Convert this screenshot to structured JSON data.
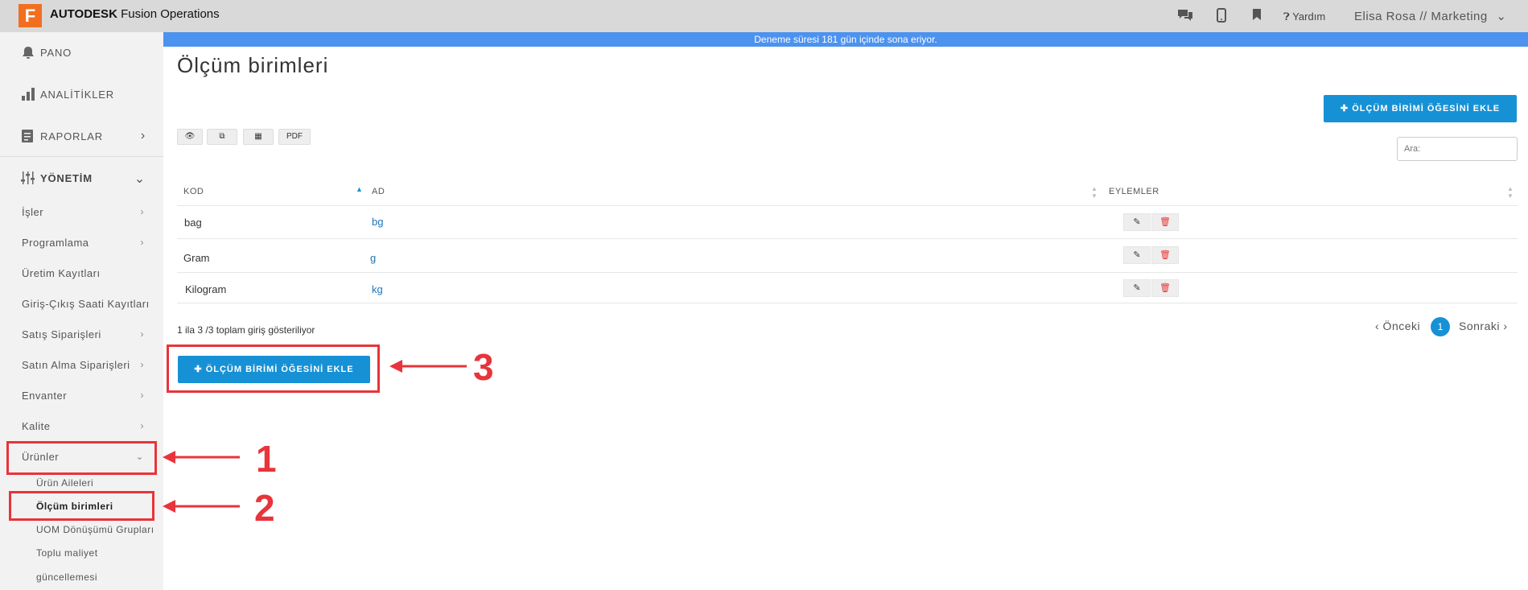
{
  "app": {
    "brand": "AUTODESK",
    "product": "Fusion Operations",
    "logo_letter": "F"
  },
  "topbar": {
    "icons": [
      "chat-icon",
      "mobile-icon",
      "bookmark-icon"
    ],
    "help_label": "Yardım",
    "user_label": "Elisa Rosa // Marketing"
  },
  "banner": "Deneme süresi 181 gün içinde sona eriyor.",
  "sidebar": {
    "main": [
      {
        "label": "PANO",
        "icon": "bell-icon"
      },
      {
        "label": "ANALİTİKLER",
        "icon": "bar-chart-icon"
      },
      {
        "label": "RAPORLAR",
        "icon": "report-icon"
      },
      {
        "label": "YÖNETİM",
        "icon": "sliders-icon"
      }
    ],
    "sub": [
      {
        "label": "İşler"
      },
      {
        "label": "Programlama"
      },
      {
        "label": "Üretim Kayıtları"
      },
      {
        "label": "Giriş-Çıkış Saati Kayıtları"
      },
      {
        "label": "Satış Siparişleri"
      },
      {
        "label": "Satın Alma Siparişleri"
      },
      {
        "label": "Envanter"
      },
      {
        "label": "Kalite"
      },
      {
        "label": "Ürünler"
      }
    ],
    "leaves": [
      {
        "label": "Ürün Aileleri"
      },
      {
        "label": "Ölçüm birimleri"
      },
      {
        "label": "UOM Dönüşümü Grupları"
      },
      {
        "label": "Toplu maliyet"
      },
      {
        "label": "güncellemesi"
      }
    ]
  },
  "page": {
    "title": "Ölçüm birimleri",
    "add_button": "ÖLÇÜM BİRİMİ ÖĞESİNİ EKLE",
    "toolbar": {
      "pdf": "PDF"
    },
    "search_placeholder": "Ara:",
    "columns": [
      "KOD",
      "AD",
      "EYLEMLER"
    ],
    "rows": [
      {
        "code": "bag",
        "name": "bg"
      },
      {
        "code": "Gram",
        "name": "g"
      },
      {
        "code": "Kilogram",
        "name": "kg"
      }
    ],
    "info": "1 ila 3 /3 toplam giriş gösteriliyor",
    "pagination": {
      "prev": "‹ Önceki",
      "current": "1",
      "next": "Sonraki ›"
    }
  },
  "annotations": {
    "labels": [
      "1",
      "2",
      "3"
    ],
    "color": "#e8343a"
  }
}
